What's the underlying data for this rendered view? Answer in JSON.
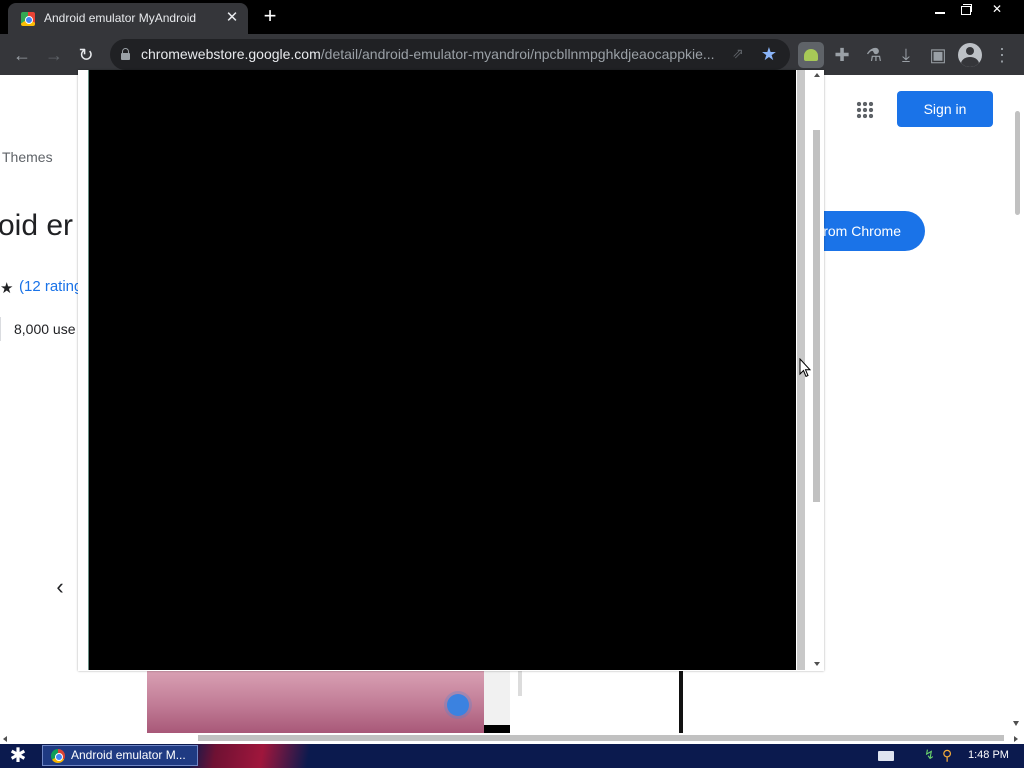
{
  "browser": {
    "tab": {
      "title": "Android emulator MyAndroid",
      "close_glyph": "✕"
    },
    "new_tab_glyph": "+",
    "window_controls": {
      "close_glyph": "✕"
    },
    "toolbar": {
      "back_glyph": "←",
      "forward_glyph": "→",
      "reload_glyph": "↻",
      "url_host": "chromewebstore.google.com",
      "url_path": "/detail/android-emulator-myandroi/npcbllnmpghkdjeaocappkie...",
      "share_glyph": "⇗",
      "star_glyph": "★",
      "puzzle_glyph": "✚",
      "flask_glyph": "⚗",
      "download_glyph": "⤓",
      "side_panel_glyph": "▣",
      "menu_glyph": "⋮"
    }
  },
  "page": {
    "themes_link": "Themes",
    "extension_title_fragment": "oid er",
    "rating_star": "★",
    "ratings_link": "(12 rating",
    "users_text": "8,000 use",
    "prev_arrow": "‹",
    "signin_label": "Sign in",
    "add_button_label": "rom Chrome"
  },
  "taskbar": {
    "start_glyph": "✱",
    "task_item_label": "Android emulator M...",
    "network_glyph": "↯",
    "search_glyph": "⚲",
    "clock": "1:48 PM"
  },
  "colors": {
    "accent_blue": "#1a73e8",
    "chrome_dark": "#35363a",
    "emulator_screen": "#000000",
    "taskbar": "#0b1a4e"
  }
}
